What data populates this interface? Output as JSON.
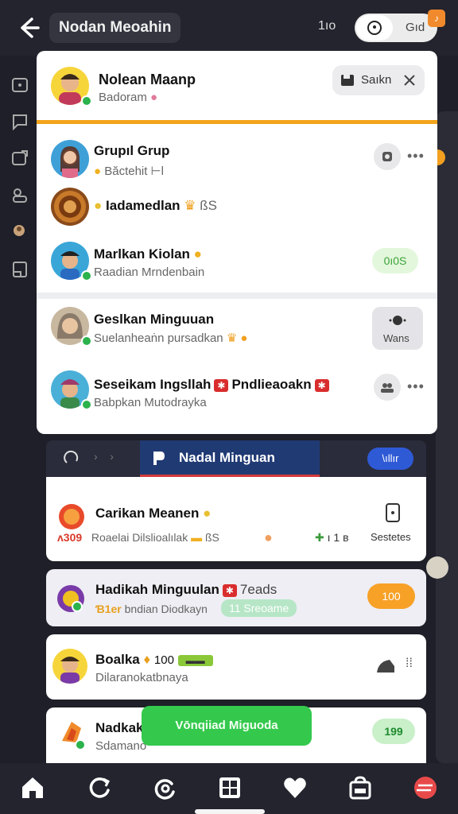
{
  "topbar": {
    "title": "Nodan Meoahin",
    "count": "1ıo",
    "toggle_label": "Gıd",
    "badge": "♪"
  },
  "header": {
    "name": "Nolean Maanp",
    "sub": "Badoram",
    "button_label": "Saıkn"
  },
  "rows": [
    {
      "name": "Grupıl Grup",
      "sub": "Băctehit ⊢l"
    },
    {
      "name": "Iadamedlan",
      "extra": "ßS"
    },
    {
      "name": "Marlkan Kiolan",
      "sub": "Raadian Mrndenbain",
      "pill": "0ı0S"
    },
    {
      "name": "Geslkan Minguuan",
      "sub": "Suelanheaṅn pursadkan",
      "box_label": "Wans"
    },
    {
      "name": "Seseikam Ingsllah",
      "tag": "Pndlieaoakn",
      "sub": "Babpkan Mutodrayka"
    }
  ],
  "panel2": {
    "title": "Nadal Minguan",
    "button_label": "\\ıllır"
  },
  "list": [
    {
      "name": "Carikan Meanen",
      "prefix": "ʌ309",
      "sub": "Roaelai Dilslioalılak",
      "extra": "ßS",
      "meta": "ı 1 ʙ",
      "side_label": "Sestetes"
    },
    {
      "name": "Hadikah Minguulan",
      "tag_suffix": "7eads",
      "prefix": "Ɓ1er",
      "sub": "bndian Diodkayn",
      "chip": "11 Sreoame",
      "pill": "100"
    },
    {
      "name": "Boalka",
      "count": "100",
      "sub": "Dilaranokatbnaya"
    },
    {
      "name": "Nadkak",
      "sub": "Sdamano",
      "pill": "199"
    }
  ],
  "toast": "Vōnqiiad Miguoda",
  "colors": {
    "accent_orange": "#f2a41b",
    "brand_blue": "#203a74",
    "success_green": "#34c94d"
  }
}
